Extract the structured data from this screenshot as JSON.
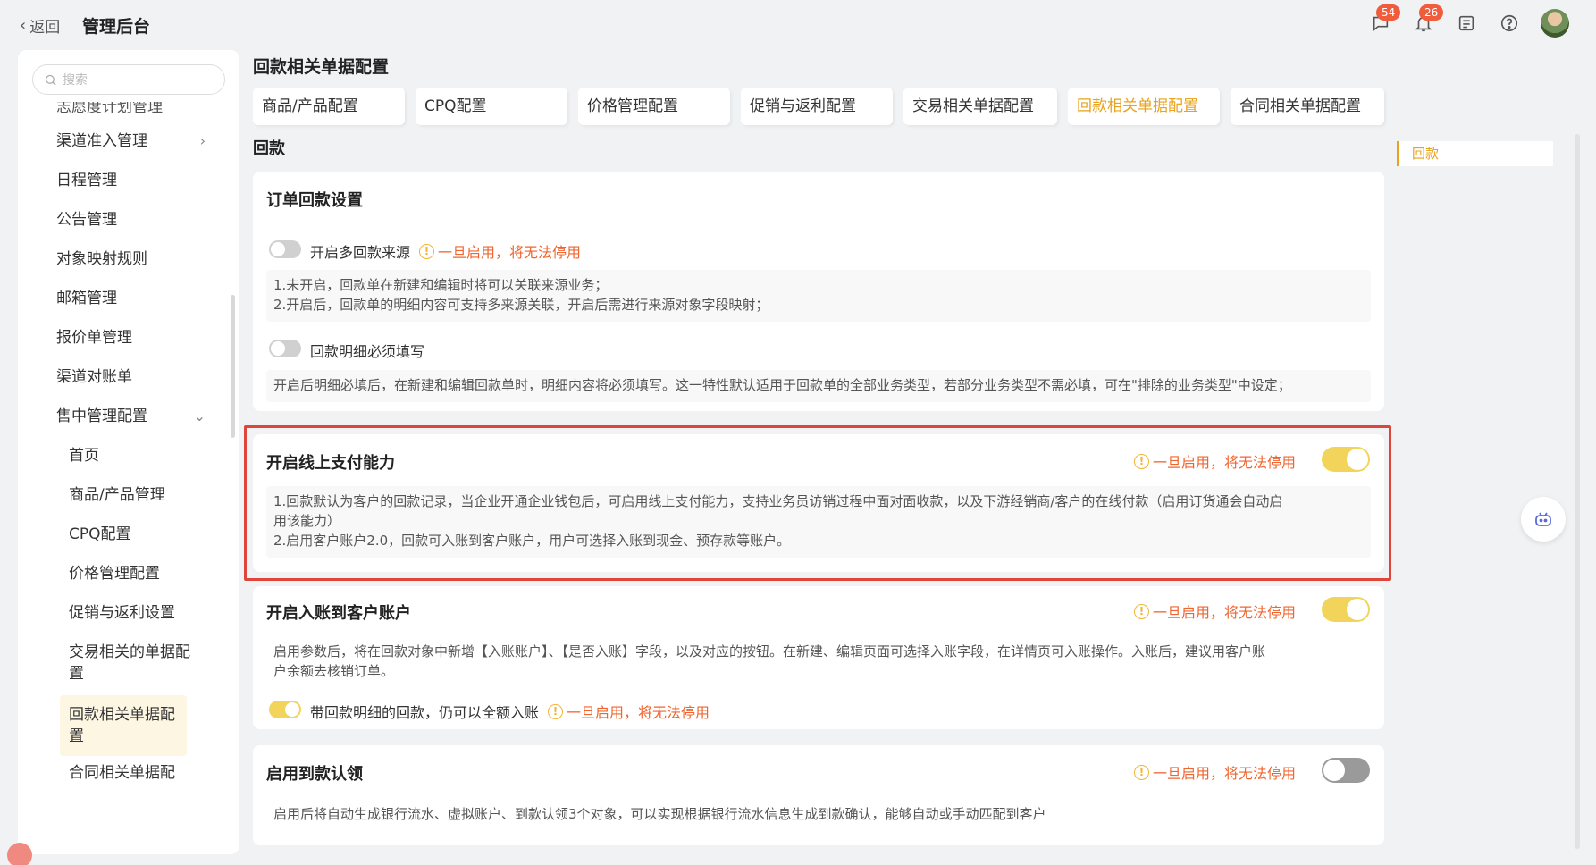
{
  "header": {
    "back_label": "返回",
    "title": "管理后台",
    "message_badge": "54",
    "notify_badge": "26"
  },
  "sidebar": {
    "search_placeholder": "搜索",
    "cut_item": "志愿度计划管理",
    "items": [
      {
        "label": "渠道准入管理"
      },
      {
        "label": "日程管理"
      },
      {
        "label": "公告管理"
      },
      {
        "label": "对象映射规则"
      },
      {
        "label": "邮箱管理"
      },
      {
        "label": "报价单管理"
      },
      {
        "label": "渠道对账单"
      },
      {
        "label": "售中管理配置"
      }
    ],
    "sub_items": [
      {
        "label": "首页"
      },
      {
        "label": "商品/产品管理"
      },
      {
        "label": "CPQ配置"
      },
      {
        "label": "价格管理配置"
      },
      {
        "label": "促销与返利设置"
      },
      {
        "label": "交易相关的单据配置"
      },
      {
        "label": "回款相关单据配置"
      },
      {
        "label": "合同相关单据配"
      }
    ]
  },
  "main": {
    "page_title": "回款相关单据配置",
    "tabs": [
      {
        "label": "商品/产品配置"
      },
      {
        "label": "CPQ配置"
      },
      {
        "label": "价格管理配置"
      },
      {
        "label": "促销与返利配置"
      },
      {
        "label": "交易相关单据配置"
      },
      {
        "label": "回款相关单据配置",
        "active": true
      },
      {
        "label": "合同相关单据配置"
      }
    ],
    "section_label": "回款",
    "anchor_label": "回款",
    "warning_text": "一旦启用，将无法停用",
    "card1": {
      "title": "订单回款设置",
      "opt1_label": "开启多回款来源",
      "opt1_on": false,
      "opt1_desc_line1": "1.未开启，回款单在新建和编辑时将可以关联来源业务；",
      "opt1_desc_line2": "2.开启后，回款单的明细内容可支持多来源关联，开启后需进行来源对象字段映射；",
      "opt2_label": "回款明细必须填写",
      "opt2_on": false,
      "opt2_desc": "开启后明细必填后，在新建和编辑回款单时，明细内容将必须填写。这一特性默认适用于回款单的全部业务类型，若部分业务类型不需必填，可在\"排除的业务类型\"中设定；"
    },
    "card2": {
      "title": "开启线上支付能力",
      "on": true,
      "desc_line1": "1.回款默认为客户的回款记录，当企业开通企业钱包后，可启用线上支付能力，支持业务员访销过程中面对面收款，以及下游经销商/客户的在线付款（启用订货通会自动启",
      "desc_line2": "用该能力）",
      "desc_line3": "2.启用客户账户2.0，回款可入账到客户账户，用户可选择入账到现金、预存款等账户。"
    },
    "card3": {
      "title": "开启入账到客户账户",
      "on": true,
      "desc_line1": "启用参数后，将在回款对象中新增【入账账户】、【是否入账】字段，以及对应的按钮。在新建、编辑页面可选择入账字段，在详情页可入账操作。入账后，建议用客户账",
      "desc_line2": "户余额去核销订单。",
      "sub_label": "带回款明细的回款，仍可以全额入账",
      "sub_on": true
    },
    "card4": {
      "title": "启用到款认领",
      "on": false,
      "desc": "启用后将自动生成银行流水、虚拟账户、到款认领3个对象，可以实现根据银行流水信息生成到款确认，能够自动或手动匹配到客户"
    }
  },
  "colors": {
    "accent": "#e8a21b",
    "warning": "#f0652f",
    "toggle_on": "#f3d45a",
    "highlight_border": "#e0453c"
  }
}
